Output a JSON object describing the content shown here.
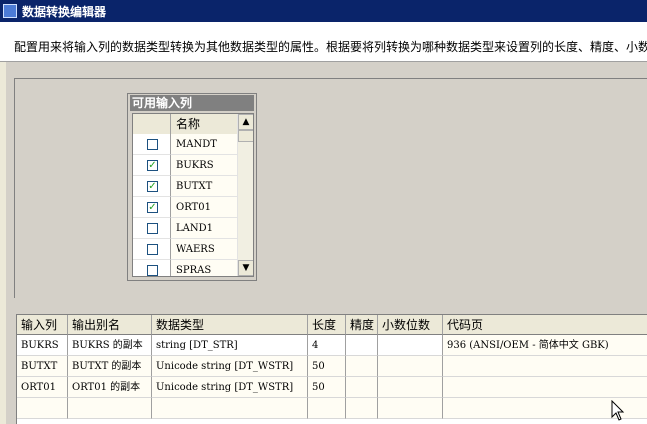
{
  "window": {
    "title": "数据转换编辑器"
  },
  "header": {
    "description": "配置用来将输入列的数据类型转换为其他数据类型的属性。根据要将列转换为哪种数据类型来设置列的长度、精度、小数"
  },
  "available_columns": {
    "title": "可用输入列",
    "name_header": "名称",
    "rows": [
      {
        "name": "MANDT",
        "checked": false
      },
      {
        "name": "BUKRS",
        "checked": true
      },
      {
        "name": "BUTXT",
        "checked": true
      },
      {
        "name": "ORT01",
        "checked": true
      },
      {
        "name": "LAND1",
        "checked": false
      },
      {
        "name": "WAERS",
        "checked": false
      },
      {
        "name": "SPRAS",
        "checked": false
      }
    ]
  },
  "grid": {
    "headers": [
      "输入列",
      "输出别名",
      "数据类型",
      "长度",
      "精度",
      "小数位数",
      "代码页"
    ],
    "rows": [
      [
        "BUKRS",
        "BUKRS 的副本",
        "string [DT_STR]",
        "4",
        "",
        "",
        "936   (ANSI/OEM - 简体中文 GBK)"
      ],
      [
        "BUTXT",
        "BUTXT 的副本",
        "Unicode string [DT_WSTR]",
        "50",
        "",
        "",
        ""
      ],
      [
        "ORT01",
        "ORT01 的副本",
        "Unicode string [DT_WSTR]",
        "50",
        "",
        "",
        ""
      ],
      [
        "",
        "",
        "",
        "",
        "",
        "",
        ""
      ]
    ]
  }
}
